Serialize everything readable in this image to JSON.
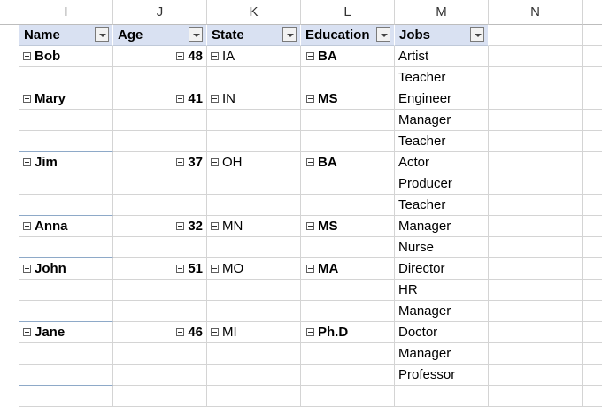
{
  "columns": [
    "I",
    "J",
    "K",
    "L",
    "M",
    "N"
  ],
  "headers": {
    "name": "Name",
    "age": "Age",
    "state": "State",
    "education": "Education",
    "jobs": "Jobs"
  },
  "rows": [
    {
      "name": "Bob",
      "age": "48",
      "state": "IA",
      "education": "BA",
      "jobs": [
        "Artist",
        "Teacher"
      ]
    },
    {
      "name": "Mary",
      "age": "41",
      "state": "IN",
      "education": "MS",
      "jobs": [
        "Engineer",
        "Manager",
        "Teacher"
      ]
    },
    {
      "name": "Jim",
      "age": "37",
      "state": "OH",
      "education": "BA",
      "jobs": [
        "Actor",
        "Producer",
        "Teacher"
      ]
    },
    {
      "name": "Anna",
      "age": "32",
      "state": "MN",
      "education": "MS",
      "jobs": [
        "Manager",
        "Nurse"
      ]
    },
    {
      "name": "John",
      "age": "51",
      "state": "MO",
      "education": "MA",
      "jobs": [
        "Director",
        "HR",
        "Manager"
      ]
    },
    {
      "name": "Jane",
      "age": "46",
      "state": "MI",
      "education": "Ph.D",
      "jobs": [
        "Doctor",
        "Manager",
        "Professor"
      ]
    }
  ]
}
